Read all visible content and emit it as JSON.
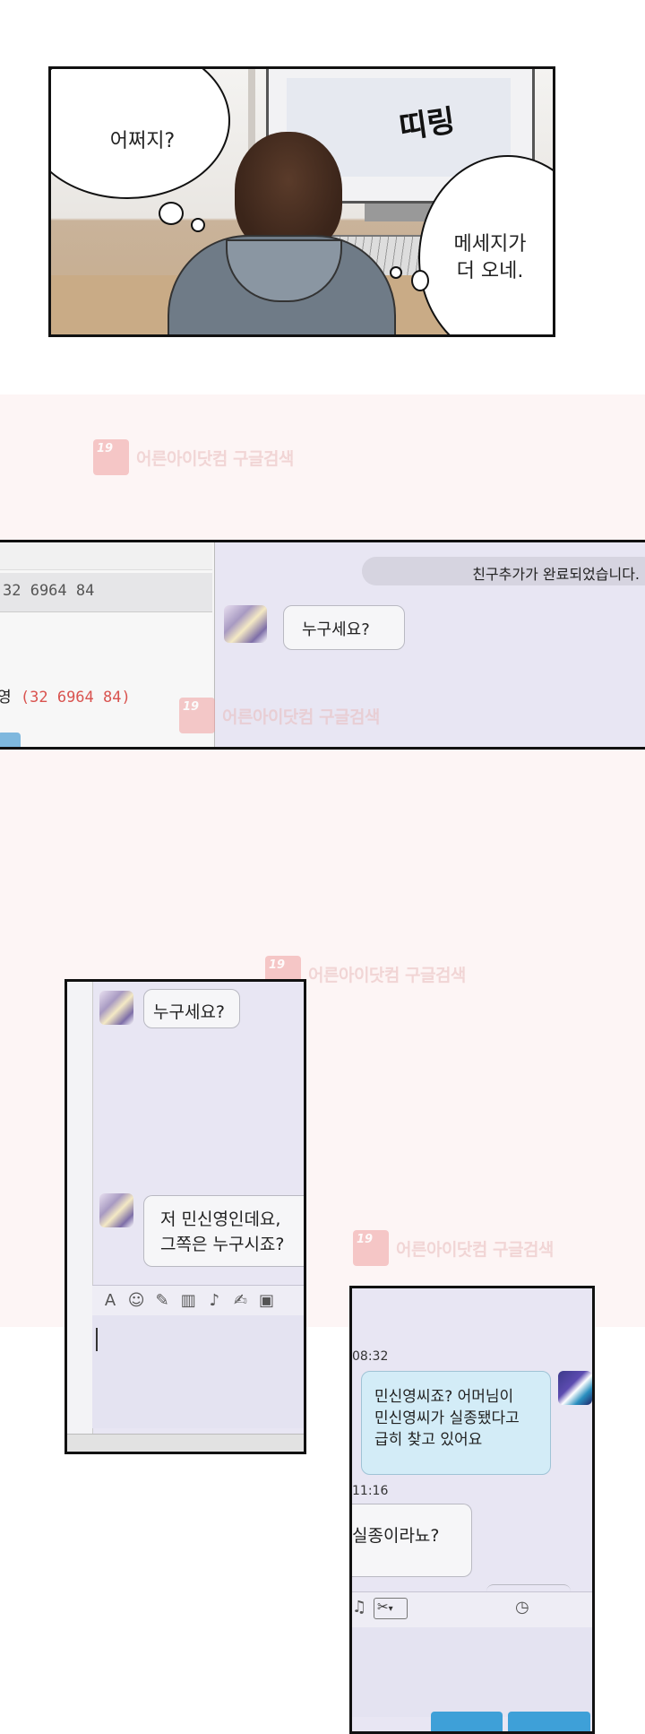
{
  "scene": {
    "thought_bubble": "어쩌지?",
    "sfx": "띠링",
    "speech_bubble_line1": "메세지가",
    "speech_bubble_line2": "더 오네."
  },
  "watermark": {
    "logo_label": "19",
    "text": "어른아이닷컴 구글검색"
  },
  "contact_panel": {
    "phone_field": "32 6964 84",
    "name_row_prefix": "영",
    "name_row_number": "(32 6964 84)"
  },
  "chat1": {
    "system_notice": "친구추가가 완료되었습니다.",
    "message": "누구세요?"
  },
  "chat2": {
    "message1": "누구세요?",
    "message2_line1": "저 민신영인데요,",
    "message2_line2": "그쪽은 누구시죠?"
  },
  "chat3": {
    "time1": "08:32",
    "msg1_line1": "민신영씨죠? 어머님이",
    "msg1_line2": "민신영씨가 실종됐다고",
    "msg1_line3": "급히 찾고 있어요",
    "time2": "11:16",
    "msg2": "실종이라뇨?"
  },
  "colors": {
    "page_background": "#ffffff",
    "pink_band": "#fdf5f5",
    "chat_background": "#e8e6f3",
    "received_bubble": "#d3ecf7",
    "red_number": "#d9534f",
    "send_button": "#3ea0d8"
  }
}
